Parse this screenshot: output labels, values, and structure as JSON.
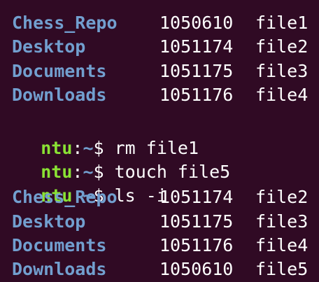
{
  "terminal": {
    "listing_before": [
      {
        "dir": "Chess_Repo",
        "inode": "1050610",
        "file": "file1"
      },
      {
        "dir": "Desktop",
        "inode": "1051174",
        "file": "file2"
      },
      {
        "dir": "Documents",
        "inode": "1051175",
        "file": "file3"
      },
      {
        "dir": "Downloads",
        "inode": "1051176",
        "file": "file4"
      }
    ],
    "commands": [
      {
        "host": "ntu",
        "sep": ":",
        "path": "~",
        "dollar": "$",
        "cmd": " rm file1"
      },
      {
        "host": "ntu",
        "sep": ":",
        "path": "~",
        "dollar": "$",
        "cmd": " touch file5"
      },
      {
        "host": "ntu",
        "sep": ":",
        "path": "~",
        "dollar": "$",
        "cmd": " ls -i"
      }
    ],
    "listing_after": [
      {
        "dir": "Chess_Repo",
        "inode": "1051174",
        "file": "file2"
      },
      {
        "dir": "Desktop",
        "inode": "1051175",
        "file": "file3"
      },
      {
        "dir": "Documents",
        "inode": "1051176",
        "file": "file4"
      },
      {
        "dir": "Downloads",
        "inode": "1050610",
        "file": "file5"
      }
    ],
    "colors": {
      "background": "#300a24",
      "directory": "#729fcf",
      "host": "#8ae234",
      "text": "#ffffff"
    }
  }
}
